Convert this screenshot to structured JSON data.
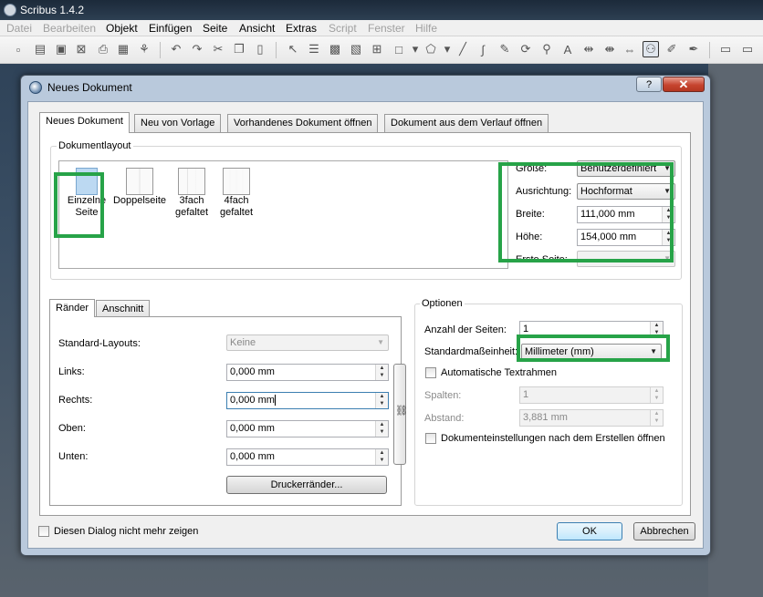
{
  "app": {
    "title": "Scribus 1.4.2",
    "menu": [
      "Datei",
      "Bearbeiten",
      "Objekt",
      "Einfügen",
      "Seite",
      "Ansicht",
      "Extras",
      "Script",
      "Fenster",
      "Hilfe"
    ]
  },
  "dialog": {
    "title": "Neues Dokument",
    "help_label": "?",
    "close_label": "✕",
    "tabs": [
      "Neues Dokument",
      "Neu von Vorlage",
      "Vorhandenes Dokument öffnen",
      "Dokument aus dem Verlauf öffnen"
    ],
    "layout_group": {
      "title": "Dokumentlayout",
      "items": [
        {
          "line1": "Einzelne",
          "line2": "Seite"
        },
        {
          "line1": "Doppelseite",
          "line2": ""
        },
        {
          "line1": "3fach",
          "line2": "gefaltet"
        },
        {
          "line1": "4fach",
          "line2": "gefaltet"
        }
      ]
    },
    "size": {
      "size_label": "Größe:",
      "size_value": "Benutzerdefiniert",
      "orientation_label": "Ausrichtung:",
      "orientation_value": "Hochformat",
      "width_label": "Breite:",
      "width_value": "111,000 mm",
      "height_label": "Höhe:",
      "height_value": "154,000 mm",
      "first_page_label": "Erste Seite:",
      "first_page_value": ""
    },
    "margins": {
      "tabs": [
        "Ränder",
        "Anschnitt"
      ],
      "standard_layouts_label": "Standard-Layouts:",
      "standard_layouts_value": "Keine",
      "left_label": "Links:",
      "left_value": "0,000 mm",
      "right_label": "Rechts:",
      "right_value": "0,000 mm",
      "top_label": "Oben:",
      "top_value": "0,000 mm",
      "bottom_label": "Unten:",
      "bottom_value": "0,000 mm",
      "printer_margins_label": "Druckerränder..."
    },
    "options": {
      "title": "Optionen",
      "pages_label": "Anzahl der Seiten:",
      "pages_value": "1",
      "unit_label": "Standardmaßeinheit:",
      "unit_value": "Millimeter (mm)",
      "auto_frames_label": "Automatische Textrahmen",
      "columns_label": "Spalten:",
      "columns_value": "1",
      "gap_label": "Abstand:",
      "gap_value": "3,881 mm",
      "open_settings_label": "Dokumenteinstellungen nach dem Erstellen öffnen"
    },
    "dont_show_label": "Diesen Dialog nicht mehr zeigen",
    "ok_label": "OK",
    "cancel_label": "Abbrechen"
  },
  "colors": {
    "highlight": "#27a348",
    "selected_page": "#bcd9f2"
  }
}
